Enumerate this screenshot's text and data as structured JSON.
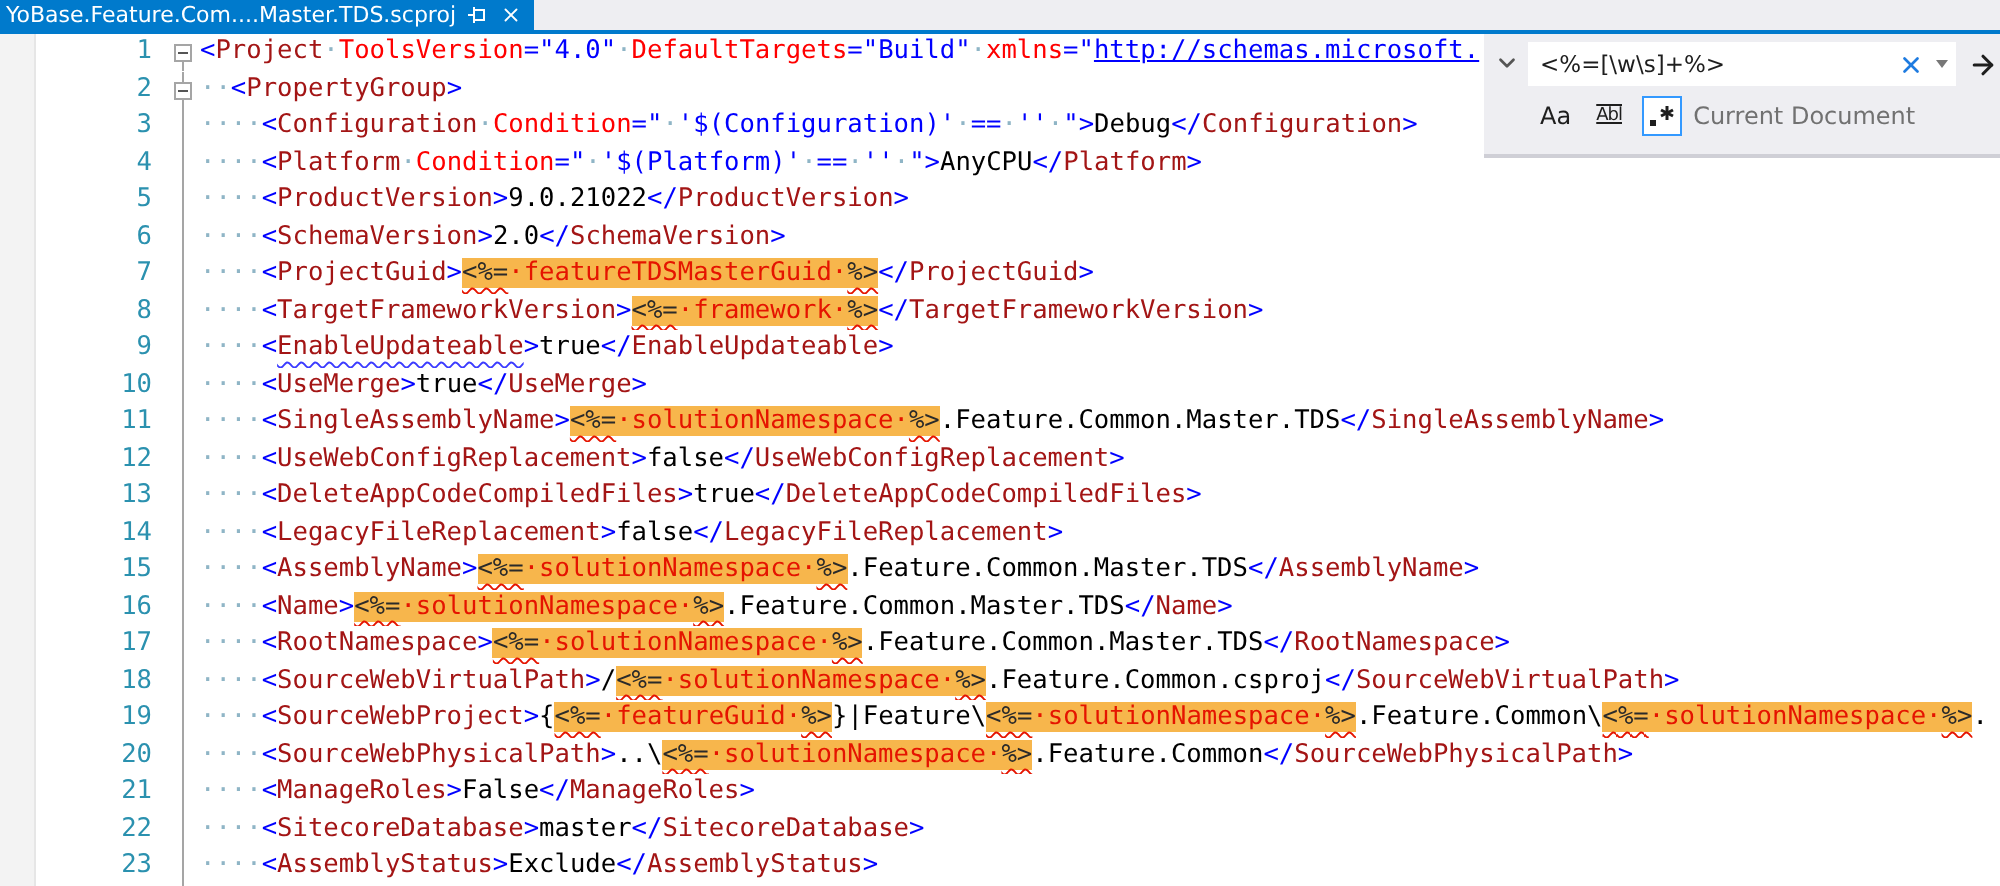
{
  "tab": {
    "title": "YoBase.Feature.Com....Master.TDS.scproj",
    "active": true
  },
  "find": {
    "expanded": true,
    "query": "<%=[\\w\\s]+%>",
    "scope": "Current Document",
    "options": [
      {
        "kind": "case",
        "label": "Aa",
        "selected": false
      },
      {
        "kind": "word",
        "label": "Abl",
        "selected": false
      },
      {
        "kind": "regex",
        "selected": true
      }
    ]
  },
  "editor": {
    "lines": [
      {
        "number": "1",
        "foldable": true,
        "tokens": [
          {
            "kind": "punct",
            "text": "<"
          },
          {
            "kind": "tag",
            "text": "Project"
          },
          {
            "kind": "space",
            "text": "·"
          },
          {
            "kind": "attr",
            "text": "ToolsVersion"
          },
          {
            "kind": "value",
            "text": "=\"4.0\""
          },
          {
            "kind": "space",
            "text": "·"
          },
          {
            "kind": "attr",
            "text": "DefaultTargets"
          },
          {
            "kind": "value",
            "text": "=\"Build\""
          },
          {
            "kind": "space",
            "text": "·"
          },
          {
            "kind": "attr",
            "text": "xmlns"
          },
          {
            "kind": "value",
            "text": "=\""
          },
          {
            "kind": "link",
            "text": "http://schemas.microsoft."
          }
        ]
      },
      {
        "number": "2",
        "foldable": true,
        "tokens": [
          {
            "kind": "space",
            "text": "··"
          },
          {
            "kind": "punct",
            "text": "<"
          },
          {
            "kind": "tag",
            "text": "PropertyGroup"
          },
          {
            "kind": "punct",
            "text": ">"
          }
        ]
      },
      {
        "number": "3",
        "foldable": false,
        "tokens": [
          {
            "kind": "space",
            "text": "····"
          },
          {
            "kind": "punct",
            "text": "<"
          },
          {
            "kind": "tag",
            "text": "Configuration"
          },
          {
            "kind": "space",
            "text": "·"
          },
          {
            "kind": "attr",
            "text": "Condition"
          },
          {
            "kind": "value",
            "text": "=\""
          },
          {
            "kind": "space",
            "text": "·"
          },
          {
            "kind": "value",
            "text": "'$(Configuration)'"
          },
          {
            "kind": "space",
            "text": "·"
          },
          {
            "kind": "value",
            "text": "=="
          },
          {
            "kind": "space",
            "text": "·"
          },
          {
            "kind": "value",
            "text": "''"
          },
          {
            "kind": "space",
            "text": "·"
          },
          {
            "kind": "value",
            "text": "\">"
          },
          {
            "kind": "text",
            "text": "Debug"
          },
          {
            "kind": "punct",
            "text": "</"
          },
          {
            "kind": "tag",
            "text": "Configuration"
          },
          {
            "kind": "punct",
            "text": ">"
          }
        ]
      },
      {
        "number": "4",
        "foldable": false,
        "tokens": [
          {
            "kind": "space",
            "text": "····"
          },
          {
            "kind": "punct",
            "text": "<"
          },
          {
            "kind": "tag",
            "text": "Platform"
          },
          {
            "kind": "space",
            "text": "·"
          },
          {
            "kind": "attr",
            "text": "Condition"
          },
          {
            "kind": "value",
            "text": "=\""
          },
          {
            "kind": "space",
            "text": "·"
          },
          {
            "kind": "value",
            "text": "'$(Platform)'"
          },
          {
            "kind": "space",
            "text": "·"
          },
          {
            "kind": "value",
            "text": "=="
          },
          {
            "kind": "space",
            "text": "·"
          },
          {
            "kind": "value",
            "text": "''"
          },
          {
            "kind": "space",
            "text": "·"
          },
          {
            "kind": "value",
            "text": "\">"
          },
          {
            "kind": "text",
            "text": "AnyCPU"
          },
          {
            "kind": "punct",
            "text": "</"
          },
          {
            "kind": "tag",
            "text": "Platform"
          },
          {
            "kind": "punct",
            "text": ">"
          }
        ]
      },
      {
        "number": "5",
        "foldable": false,
        "tokens": [
          {
            "kind": "space",
            "text": "····"
          },
          {
            "kind": "punct",
            "text": "<"
          },
          {
            "kind": "tag",
            "text": "ProductVersion"
          },
          {
            "kind": "punct",
            "text": ">"
          },
          {
            "kind": "text",
            "text": "9.0.21022"
          },
          {
            "kind": "punct",
            "text": "</"
          },
          {
            "kind": "tag",
            "text": "ProductVersion"
          },
          {
            "kind": "punct",
            "text": ">"
          }
        ]
      },
      {
        "number": "6",
        "foldable": false,
        "tokens": [
          {
            "kind": "space",
            "text": "····"
          },
          {
            "kind": "punct",
            "text": "<"
          },
          {
            "kind": "tag",
            "text": "SchemaVersion"
          },
          {
            "kind": "punct",
            "text": ">"
          },
          {
            "kind": "text",
            "text": "2.0"
          },
          {
            "kind": "punct",
            "text": "</"
          },
          {
            "kind": "tag",
            "text": "SchemaVersion"
          },
          {
            "kind": "punct",
            "text": ">"
          }
        ]
      },
      {
        "number": "7",
        "foldable": false,
        "tokens": [
          {
            "kind": "space",
            "text": "····"
          },
          {
            "kind": "punct",
            "text": "<"
          },
          {
            "kind": "tag",
            "text": "ProjectGuid"
          },
          {
            "kind": "punct",
            "text": ">"
          },
          {
            "kind": "match",
            "open": "<%=",
            "name": "·featureTDSMasterGuid·",
            "close": "%>"
          },
          {
            "kind": "punct",
            "text": "</"
          },
          {
            "kind": "tag",
            "text": "ProjectGuid"
          },
          {
            "kind": "punct",
            "text": ">"
          }
        ]
      },
      {
        "number": "8",
        "foldable": false,
        "tokens": [
          {
            "kind": "space",
            "text": "····"
          },
          {
            "kind": "punct",
            "text": "<"
          },
          {
            "kind": "tag",
            "text": "TargetFrameworkVersion"
          },
          {
            "kind": "punct",
            "text": ">"
          },
          {
            "kind": "match",
            "open": "<%=",
            "name": "·framework·",
            "close": "%>"
          },
          {
            "kind": "punct",
            "text": "</"
          },
          {
            "kind": "tag",
            "text": "TargetFrameworkVersion"
          },
          {
            "kind": "punct",
            "text": ">"
          }
        ]
      },
      {
        "number": "9",
        "foldable": false,
        "tokens": [
          {
            "kind": "space",
            "text": "····"
          },
          {
            "kind": "punct",
            "text": "<"
          },
          {
            "kind": "warning",
            "text": "EnableUpdateable"
          },
          {
            "kind": "punct",
            "text": ">"
          },
          {
            "kind": "text",
            "text": "true"
          },
          {
            "kind": "punct",
            "text": "</"
          },
          {
            "kind": "tag",
            "text": "EnableUpdateable"
          },
          {
            "kind": "punct",
            "text": ">"
          }
        ]
      },
      {
        "number": "10",
        "foldable": false,
        "tokens": [
          {
            "kind": "space",
            "text": "····"
          },
          {
            "kind": "punct",
            "text": "<"
          },
          {
            "kind": "tag",
            "text": "UseMerge"
          },
          {
            "kind": "punct",
            "text": ">"
          },
          {
            "kind": "text",
            "text": "true"
          },
          {
            "kind": "punct",
            "text": "</"
          },
          {
            "kind": "tag",
            "text": "UseMerge"
          },
          {
            "kind": "punct",
            "text": ">"
          }
        ]
      },
      {
        "number": "11",
        "foldable": false,
        "tokens": [
          {
            "kind": "space",
            "text": "····"
          },
          {
            "kind": "punct",
            "text": "<"
          },
          {
            "kind": "tag",
            "text": "SingleAssemblyName"
          },
          {
            "kind": "punct",
            "text": ">"
          },
          {
            "kind": "match",
            "open": "<%=",
            "name": "·solutionNamespace·",
            "close": "%>"
          },
          {
            "kind": "text",
            "text": ".Feature.Common.Master.TDS"
          },
          {
            "kind": "punct",
            "text": "</"
          },
          {
            "kind": "tag",
            "text": "SingleAssemblyName"
          },
          {
            "kind": "punct",
            "text": ">"
          }
        ]
      },
      {
        "number": "12",
        "foldable": false,
        "tokens": [
          {
            "kind": "space",
            "text": "····"
          },
          {
            "kind": "punct",
            "text": "<"
          },
          {
            "kind": "tag",
            "text": "UseWebConfigReplacement"
          },
          {
            "kind": "punct",
            "text": ">"
          },
          {
            "kind": "text",
            "text": "false"
          },
          {
            "kind": "punct",
            "text": "</"
          },
          {
            "kind": "tag",
            "text": "UseWebConfigReplacement"
          },
          {
            "kind": "punct",
            "text": ">"
          }
        ]
      },
      {
        "number": "13",
        "foldable": false,
        "tokens": [
          {
            "kind": "space",
            "text": "····"
          },
          {
            "kind": "punct",
            "text": "<"
          },
          {
            "kind": "tag",
            "text": "DeleteAppCodeCompiledFiles"
          },
          {
            "kind": "punct",
            "text": ">"
          },
          {
            "kind": "text",
            "text": "true"
          },
          {
            "kind": "punct",
            "text": "</"
          },
          {
            "kind": "tag",
            "text": "DeleteAppCodeCompiledFiles"
          },
          {
            "kind": "punct",
            "text": ">"
          }
        ]
      },
      {
        "number": "14",
        "foldable": false,
        "tokens": [
          {
            "kind": "space",
            "text": "····"
          },
          {
            "kind": "punct",
            "text": "<"
          },
          {
            "kind": "tag",
            "text": "LegacyFileReplacement"
          },
          {
            "kind": "punct",
            "text": ">"
          },
          {
            "kind": "text",
            "text": "false"
          },
          {
            "kind": "punct",
            "text": "</"
          },
          {
            "kind": "tag",
            "text": "LegacyFileReplacement"
          },
          {
            "kind": "punct",
            "text": ">"
          }
        ]
      },
      {
        "number": "15",
        "foldable": false,
        "tokens": [
          {
            "kind": "space",
            "text": "····"
          },
          {
            "kind": "punct",
            "text": "<"
          },
          {
            "kind": "tag",
            "text": "AssemblyName"
          },
          {
            "kind": "punct",
            "text": ">"
          },
          {
            "kind": "match",
            "open": "<%=",
            "name": "·solutionNamespace·",
            "close": "%>"
          },
          {
            "kind": "text",
            "text": ".Feature.Common.Master.TDS"
          },
          {
            "kind": "punct",
            "text": "</"
          },
          {
            "kind": "tag",
            "text": "AssemblyName"
          },
          {
            "kind": "punct",
            "text": ">"
          }
        ]
      },
      {
        "number": "16",
        "foldable": false,
        "tokens": [
          {
            "kind": "space",
            "text": "····"
          },
          {
            "kind": "punct",
            "text": "<"
          },
          {
            "kind": "tag",
            "text": "Name"
          },
          {
            "kind": "punct",
            "text": ">"
          },
          {
            "kind": "match",
            "open": "<%=",
            "name": "·solutionNamespace·",
            "close": "%>"
          },
          {
            "kind": "text",
            "text": ".Feature.Common.Master.TDS"
          },
          {
            "kind": "punct",
            "text": "</"
          },
          {
            "kind": "tag",
            "text": "Name"
          },
          {
            "kind": "punct",
            "text": ">"
          }
        ]
      },
      {
        "number": "17",
        "foldable": false,
        "tokens": [
          {
            "kind": "space",
            "text": "····"
          },
          {
            "kind": "punct",
            "text": "<"
          },
          {
            "kind": "tag",
            "text": "RootNamespace"
          },
          {
            "kind": "punct",
            "text": ">"
          },
          {
            "kind": "match",
            "open": "<%=",
            "name": "·solutionNamespace·",
            "close": "%>"
          },
          {
            "kind": "text",
            "text": ".Feature.Common.Master.TDS"
          },
          {
            "kind": "punct",
            "text": "</"
          },
          {
            "kind": "tag",
            "text": "RootNamespace"
          },
          {
            "kind": "punct",
            "text": ">"
          }
        ]
      },
      {
        "number": "18",
        "foldable": false,
        "tokens": [
          {
            "kind": "space",
            "text": "····"
          },
          {
            "kind": "punct",
            "text": "<"
          },
          {
            "kind": "tag",
            "text": "SourceWebVirtualPath"
          },
          {
            "kind": "punct",
            "text": ">"
          },
          {
            "kind": "text",
            "text": "/"
          },
          {
            "kind": "match",
            "open": "<%=",
            "name": "·solutionNamespace·",
            "close": "%>"
          },
          {
            "kind": "text",
            "text": ".Feature.Common.csproj"
          },
          {
            "kind": "punct",
            "text": "</"
          },
          {
            "kind": "tag",
            "text": "SourceWebVirtualPath"
          },
          {
            "kind": "punct",
            "text": ">"
          }
        ]
      },
      {
        "number": "19",
        "foldable": false,
        "tokens": [
          {
            "kind": "space",
            "text": "····"
          },
          {
            "kind": "punct",
            "text": "<"
          },
          {
            "kind": "tag",
            "text": "SourceWebProject"
          },
          {
            "kind": "punct",
            "text": ">"
          },
          {
            "kind": "text",
            "text": "{"
          },
          {
            "kind": "match",
            "open": "<%=",
            "name": "·featureGuid·",
            "close": "%>"
          },
          {
            "kind": "text",
            "text": "}|Feature\\"
          },
          {
            "kind": "match",
            "open": "<%=",
            "name": "·solutionNamespace·",
            "close": "%>"
          },
          {
            "kind": "text",
            "text": ".Feature.Common\\"
          },
          {
            "kind": "match",
            "open": "<%=",
            "name": "·solutionNamespace·",
            "close": "%>"
          },
          {
            "kind": "text",
            "text": "."
          }
        ]
      },
      {
        "number": "20",
        "foldable": false,
        "tokens": [
          {
            "kind": "space",
            "text": "····"
          },
          {
            "kind": "punct",
            "text": "<"
          },
          {
            "kind": "tag",
            "text": "SourceWebPhysicalPath"
          },
          {
            "kind": "punct",
            "text": ">"
          },
          {
            "kind": "text",
            "text": "..\\"
          },
          {
            "kind": "match",
            "open": "<%=",
            "name": "·solutionNamespace·",
            "close": "%>"
          },
          {
            "kind": "text",
            "text": ".Feature.Common"
          },
          {
            "kind": "punct",
            "text": "</"
          },
          {
            "kind": "tag",
            "text": "SourceWebPhysicalPath"
          },
          {
            "kind": "punct",
            "text": ">"
          }
        ]
      },
      {
        "number": "21",
        "foldable": false,
        "tokens": [
          {
            "kind": "space",
            "text": "····"
          },
          {
            "kind": "punct",
            "text": "<"
          },
          {
            "kind": "tag",
            "text": "ManageRoles"
          },
          {
            "kind": "punct",
            "text": ">"
          },
          {
            "kind": "text",
            "text": "False"
          },
          {
            "kind": "punct",
            "text": "</"
          },
          {
            "kind": "tag",
            "text": "ManageRoles"
          },
          {
            "kind": "punct",
            "text": ">"
          }
        ]
      },
      {
        "number": "22",
        "foldable": false,
        "tokens": [
          {
            "kind": "space",
            "text": "····"
          },
          {
            "kind": "punct",
            "text": "<"
          },
          {
            "kind": "tag",
            "text": "SitecoreDatabase"
          },
          {
            "kind": "punct",
            "text": ">"
          },
          {
            "kind": "text",
            "text": "master"
          },
          {
            "kind": "punct",
            "text": "</"
          },
          {
            "kind": "tag",
            "text": "SitecoreDatabase"
          },
          {
            "kind": "punct",
            "text": ">"
          }
        ]
      },
      {
        "number": "23",
        "foldable": false,
        "tokens": [
          {
            "kind": "space",
            "text": "····"
          },
          {
            "kind": "punct",
            "text": "<"
          },
          {
            "kind": "tag",
            "text": "AssemblyStatus"
          },
          {
            "kind": "punct",
            "text": ">"
          },
          {
            "kind": "text",
            "text": "Exclude"
          },
          {
            "kind": "punct",
            "text": "</"
          },
          {
            "kind": "tag",
            "text": "AssemblyStatus"
          },
          {
            "kind": "punct",
            "text": ">"
          }
        ]
      }
    ]
  }
}
